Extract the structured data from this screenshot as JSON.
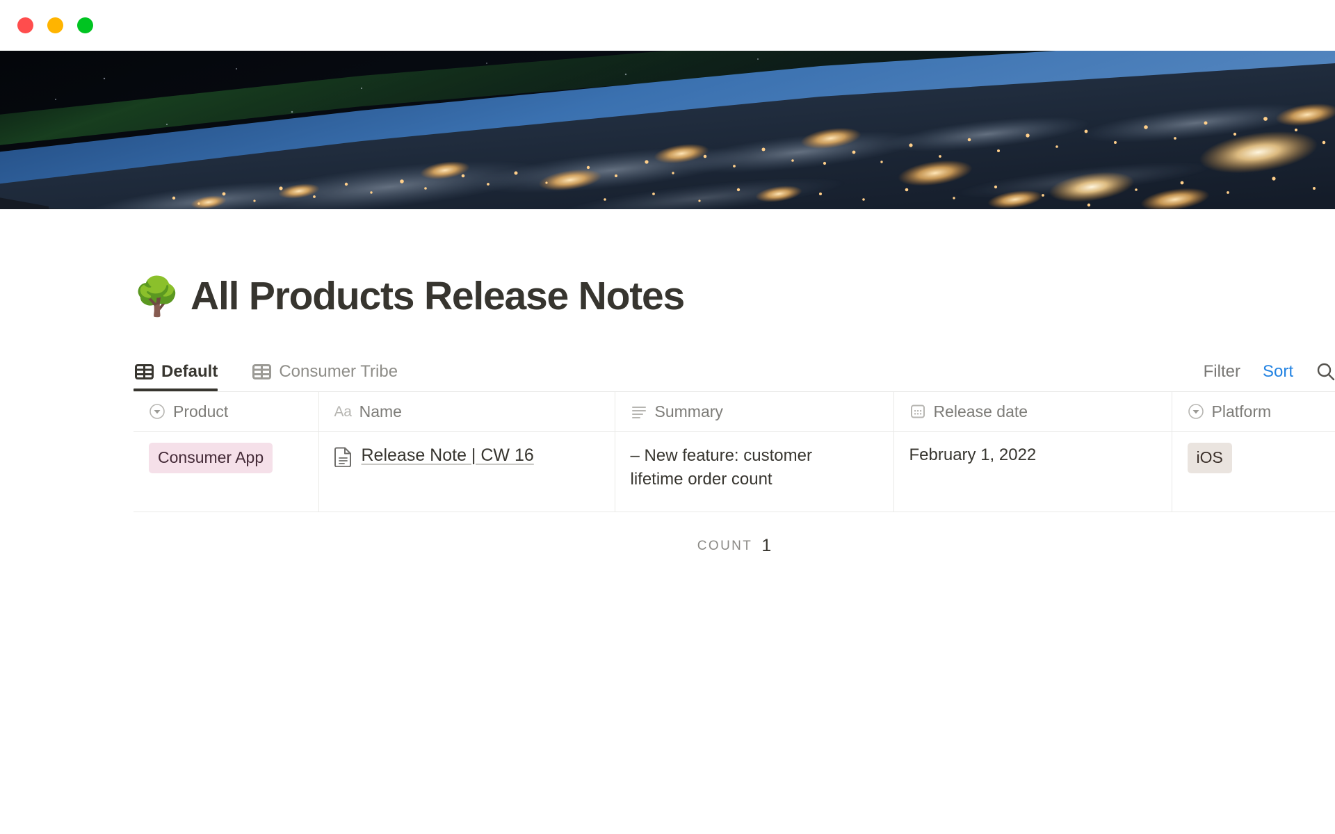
{
  "window": {
    "traffic_lights": [
      {
        "name": "close",
        "color": "#FF4D4D"
      },
      {
        "name": "minimize",
        "color": "#FFB400"
      },
      {
        "name": "maximize",
        "color": "#00C421"
      }
    ]
  },
  "cover": {
    "alt": "Night-time satellite photograph of Earth from orbit with city lights",
    "sky_color": "#05070c",
    "limb_color": "#2f5d94",
    "earth_color": "#1d2a3a",
    "lights_color": "#ffc87a"
  },
  "header": {
    "emoji": "🌳",
    "emoji_name": "deciduous-tree-emoji",
    "title": "All Products Release Notes"
  },
  "viewbar": {
    "tabs": [
      {
        "label": "Default",
        "icon": "table-icon",
        "active": true
      },
      {
        "label": "Consumer Tribe",
        "icon": "table-icon",
        "active": false
      }
    ],
    "actions": {
      "filter_label": "Filter",
      "sort_label": "Sort",
      "search_icon": "search-icon",
      "sort_color": "#2383E2",
      "filter_color": "#787774"
    }
  },
  "table": {
    "columns": [
      {
        "label": "Product",
        "icon": "select-icon"
      },
      {
        "label": "Name",
        "icon": "title-aa-icon"
      },
      {
        "label": "Summary",
        "icon": "text-lines-icon"
      },
      {
        "label": "Release date",
        "icon": "calendar-icon"
      },
      {
        "label": "Platform",
        "icon": "select-icon"
      }
    ],
    "rows": [
      {
        "product": "Consumer App",
        "product_tag_bg": "#f5e0e9",
        "product_tag_fg": "#442a37",
        "name": "Release Note | CW 16",
        "name_icon": "page-document-icon",
        "summary": "– New feature: customer lifetime order count",
        "release_date": "February 1, 2022",
        "platform": "iOS",
        "platform_tag_bg": "#eae4df",
        "platform_tag_fg": "#3b302a"
      }
    ],
    "footer": {
      "count_label": "Count",
      "count_value": "1"
    }
  }
}
